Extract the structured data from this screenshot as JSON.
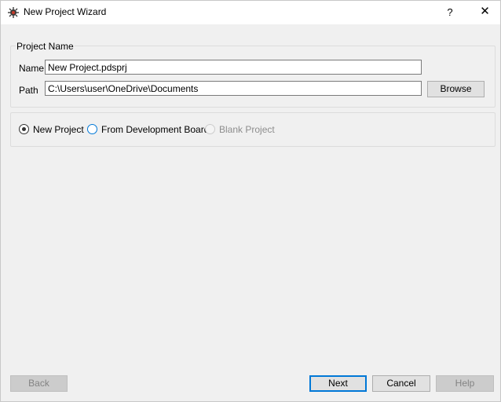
{
  "window": {
    "title": "New Project Wizard",
    "help_symbol": "?",
    "close_symbol": "✕"
  },
  "project_group": {
    "title": "Project Name",
    "name_label": "Name",
    "name_value": "New Project.pdsprj",
    "path_label": "Path",
    "path_value": "C:\\Users\\user\\OneDrive\\Documents",
    "browse_label": "Browse"
  },
  "options": {
    "new_project": "New Project",
    "from_board": "From Development Board",
    "blank": "Blank Project",
    "selected": "new_project"
  },
  "footer": {
    "back": "Back",
    "next": "Next",
    "cancel": "Cancel",
    "help": "Help"
  },
  "colors": {
    "accent": "#0078d7",
    "window_bg": "#f0f0f0"
  },
  "icons": {
    "app": "gear-bug-icon",
    "help": "question-mark",
    "close": "close-icon"
  }
}
